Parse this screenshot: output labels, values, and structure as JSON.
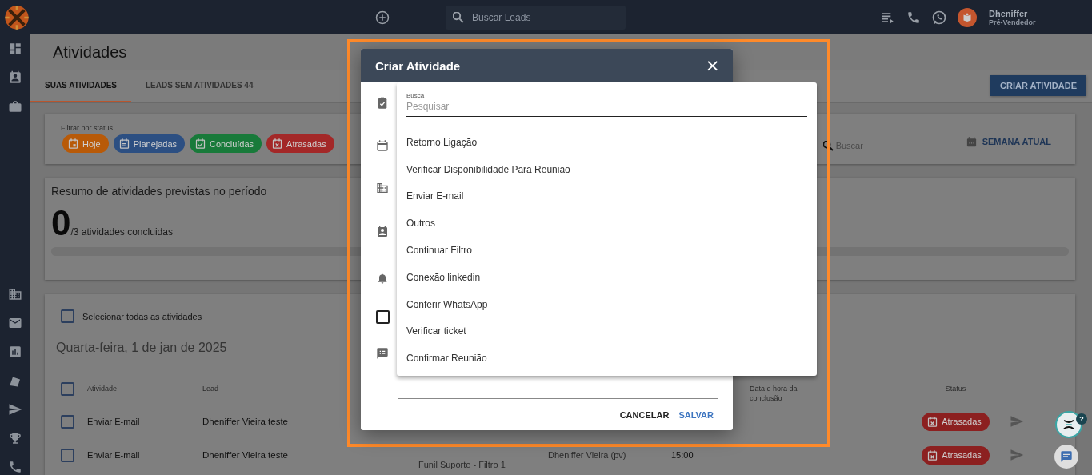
{
  "topbar": {
    "search_placeholder": "Buscar Leads",
    "user_name": "Dheniffer",
    "user_role": "Pré-Vendedor"
  },
  "page": {
    "title": "Atividades",
    "create_button": "CRIAR ATIVIDADE",
    "tabs": [
      {
        "label": "SUAS ATIVIDADES",
        "selected": true
      },
      {
        "label": "LEADS SEM ATIVIDADES 44",
        "selected": false
      }
    ]
  },
  "filter": {
    "label": "Filtrar por status",
    "search_placeholder": "Buscar",
    "week_button": "SEMANA ATUAL",
    "chips": [
      {
        "label": "Hoje",
        "kind": "today",
        "color": "#b85a08"
      },
      {
        "label": "Planejadas",
        "kind": "planned",
        "color": "#2c4f82"
      },
      {
        "label": "Concluídas",
        "kind": "done",
        "color": "#187a3a"
      },
      {
        "label": "Atrasadas",
        "kind": "late",
        "color": "#a32828"
      }
    ]
  },
  "summary": {
    "title": "Resumo de atividades previstas no período",
    "done": "0",
    "total": "/3 atividades concluidas",
    "level": 0
  },
  "list": {
    "select_all": {
      "label": "Selecionar todas as atividades",
      "checked": false
    },
    "date": "Quarta-feira, 1 de jan de 2025",
    "header_checked": false,
    "columns": {
      "activity": "Atividade",
      "lead": "Lead",
      "conclusion": "Data e hora da conclusão",
      "status": "Status"
    },
    "rows": [
      {
        "checked": false,
        "activity": "Enviar E-mail",
        "lead": "Dheniffer Vieira teste",
        "status": {
          "label": "Atrasadas",
          "color": "#8c2020"
        }
      },
      {
        "checked": false,
        "activity": "Enviar E-mail",
        "lead": "Dheniffer Vieira teste",
        "funnel": "Funil Suporte - Filtro 1",
        "owner": "Dheniffer Vieira (pv)",
        "time": "15:00",
        "status": {
          "label": "Atrasadas",
          "color": "#8c2020"
        }
      }
    ]
  },
  "modal": {
    "title": "Criar Atividade",
    "close": "×",
    "checkbox_checked": false,
    "cancel": "CANCELAR",
    "save": "SALVAR"
  },
  "dropdown": {
    "label": "Busca",
    "placeholder": "Pesquisar",
    "options": [
      "Retorno Ligação",
      "Verificar Disponibilidade Para Reunião",
      "Enviar E-mail",
      "Outros",
      "Continuar Filtro",
      "Conexão linkedin",
      "Conferir WhatsApp",
      "Verificar ticket",
      "Confirmar Reunião"
    ]
  },
  "help_badge": "?"
}
